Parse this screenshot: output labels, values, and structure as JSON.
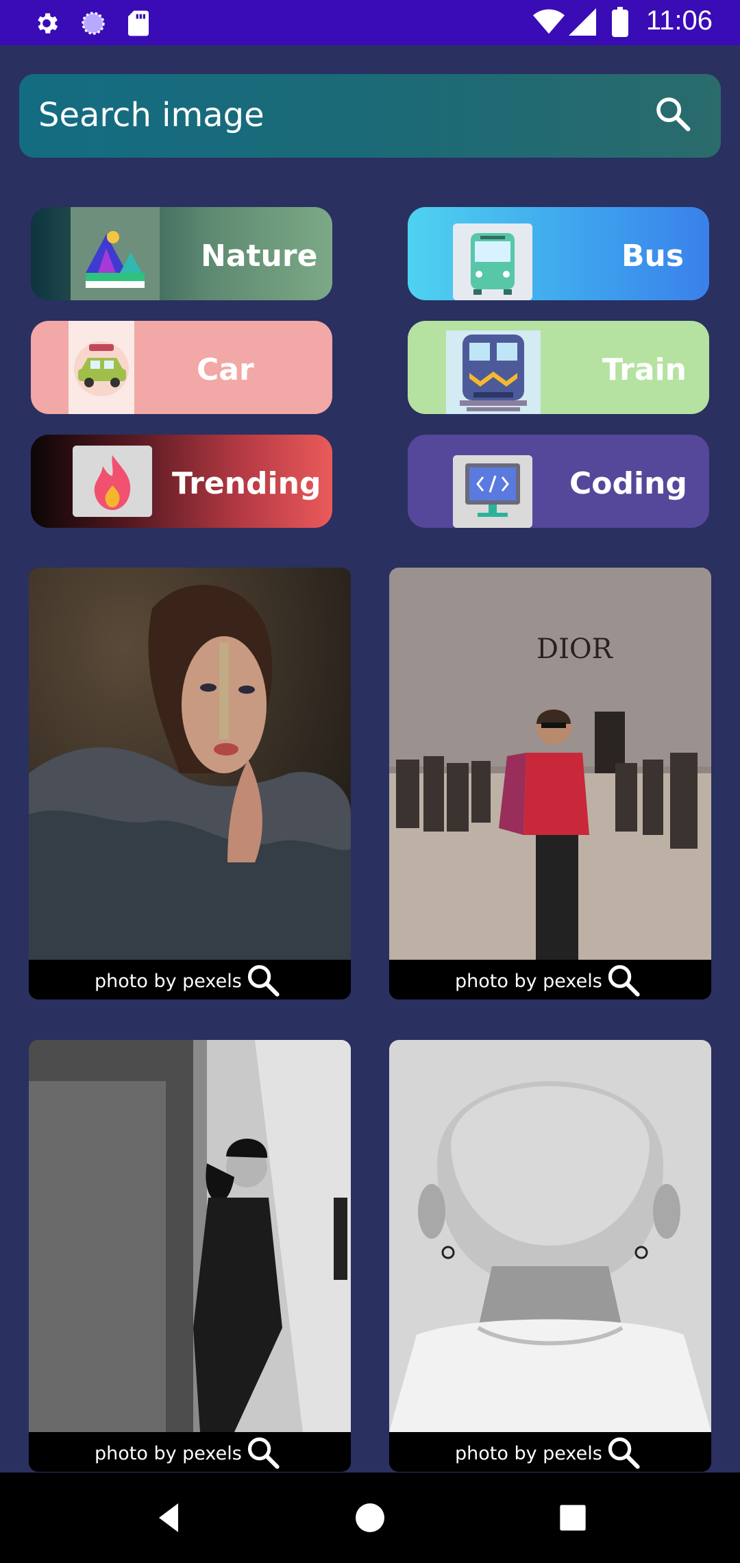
{
  "status_bar": {
    "time": "11:06",
    "icons": [
      "gear-icon",
      "loading-circle-icon",
      "sd-card-icon",
      "wifi-icon",
      "signal-icon",
      "battery-icon"
    ]
  },
  "search": {
    "placeholder": "Search image",
    "icon": "search-icon"
  },
  "categories": [
    {
      "label": "Nature",
      "icon": "mountain-landscape-icon"
    },
    {
      "label": "Bus",
      "icon": "bus-icon"
    },
    {
      "label": "Car",
      "icon": "car-icon"
    },
    {
      "label": "Train",
      "icon": "train-icon"
    },
    {
      "label": "Trending",
      "icon": "flame-icon"
    },
    {
      "label": "Coding",
      "icon": "monitor-code-icon"
    }
  ],
  "photos": [
    {
      "caption": "photo by pexels",
      "subject": "woman-portrait"
    },
    {
      "caption": "photo by pexels",
      "subject": "man-street-dior",
      "sign_text": "DIOR"
    },
    {
      "caption": "photo by pexels",
      "subject": "woman-alley-bw"
    },
    {
      "caption": "photo by pexels",
      "subject": "back-of-head-bw"
    }
  ],
  "colors": {
    "background": "#2a3060",
    "status_bar": "#3a0cb6",
    "search_bar": "#1c6a76",
    "caption_bar": "#000000"
  },
  "nav": {
    "buttons": [
      "back-icon",
      "home-icon",
      "recents-icon"
    ]
  }
}
